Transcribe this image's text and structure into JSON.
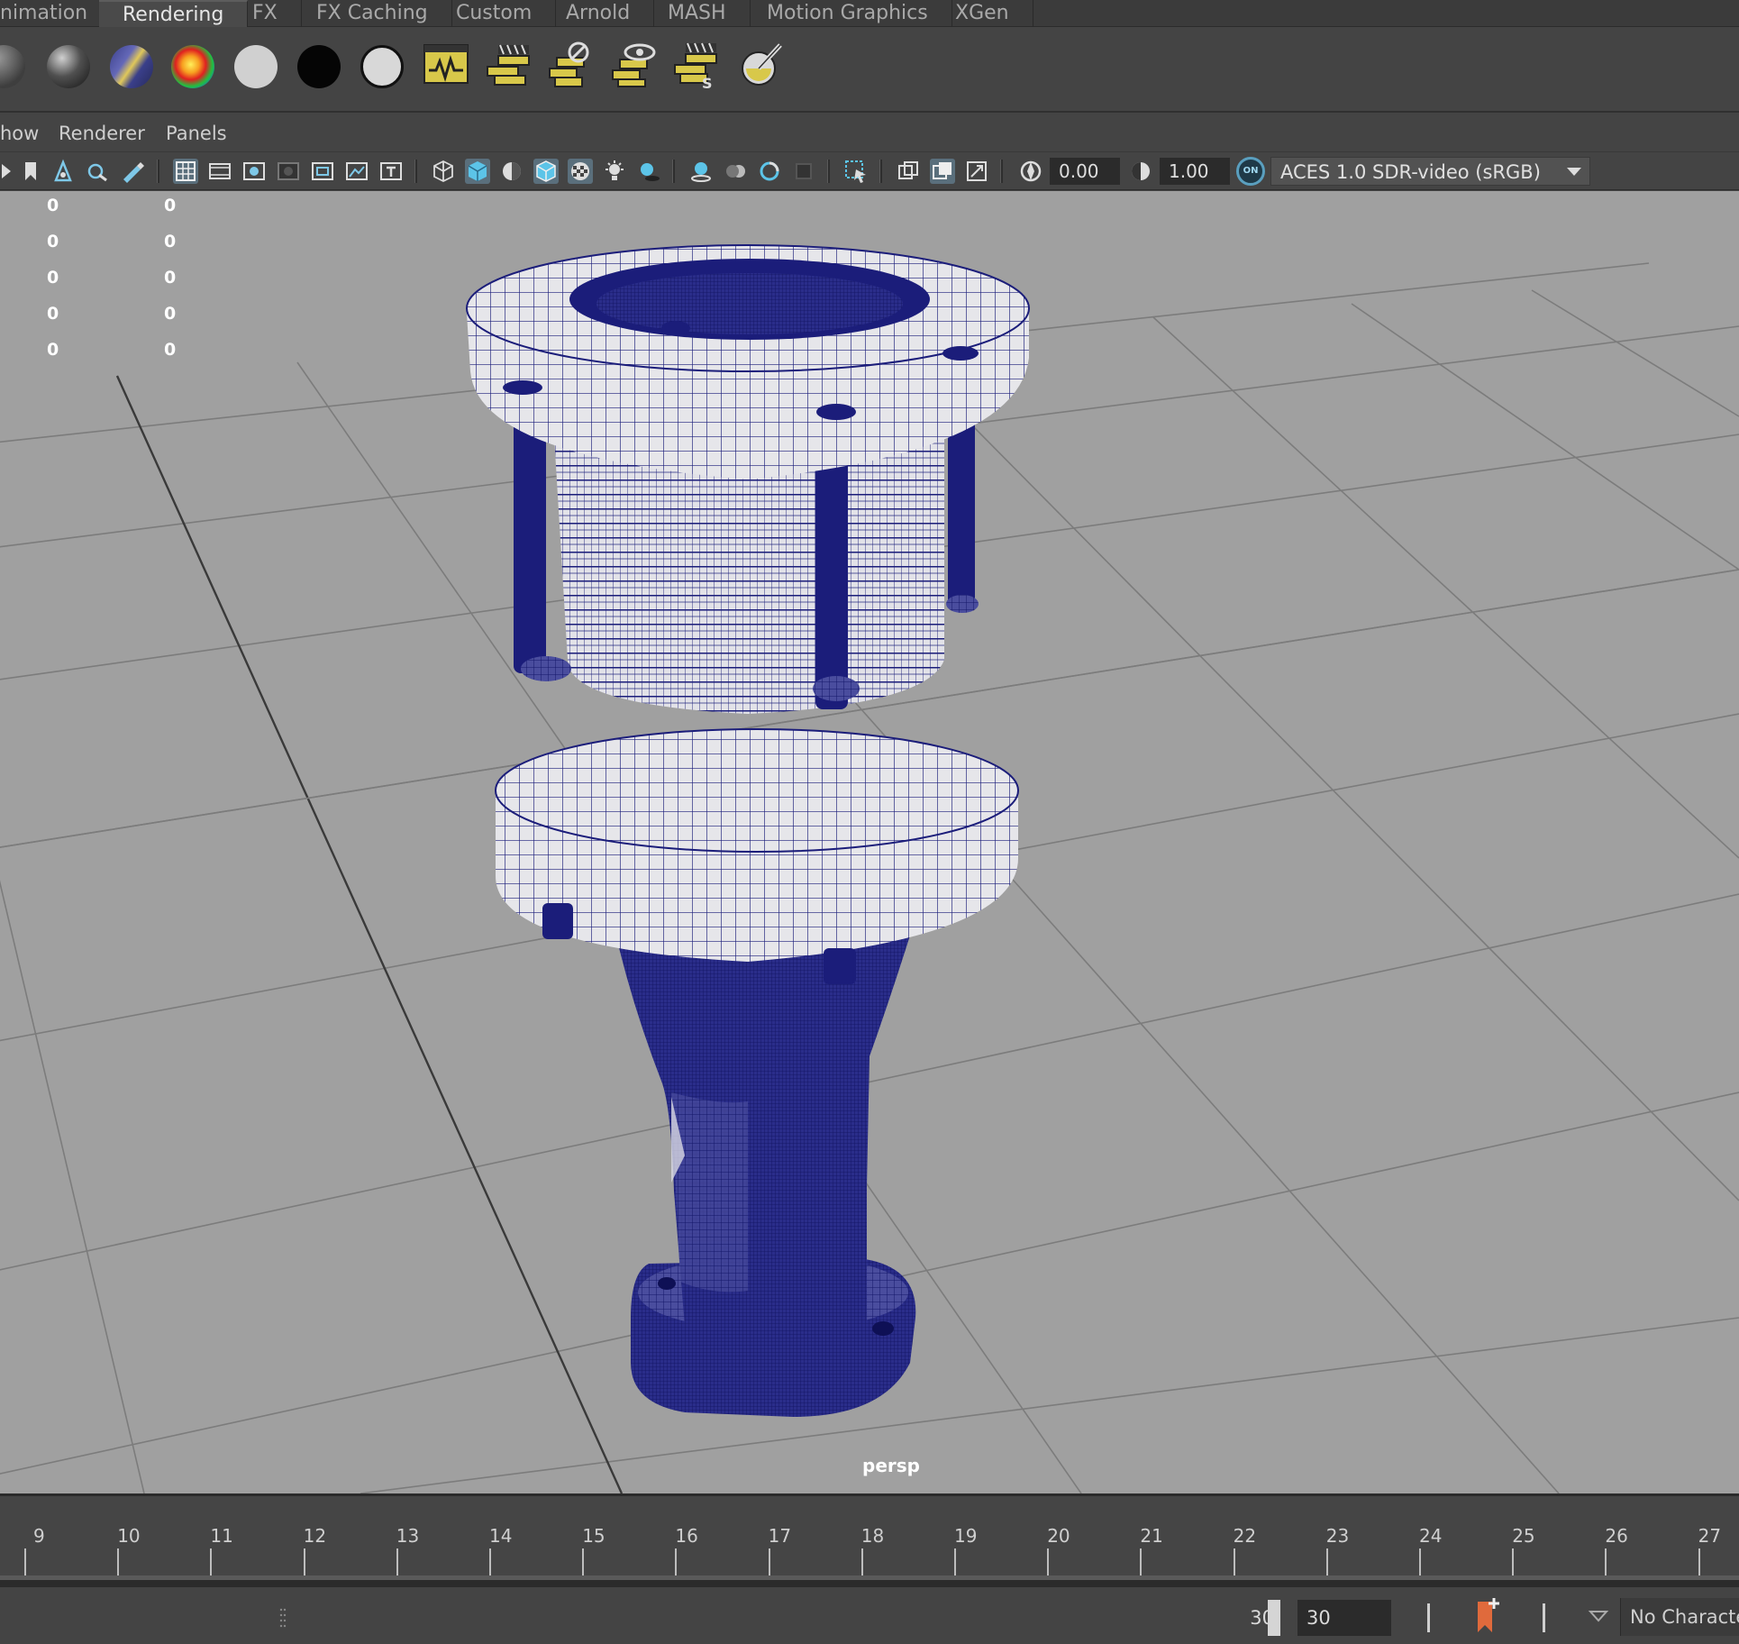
{
  "shelf_tabs": [
    {
      "label": "nimation",
      "active": false
    },
    {
      "label": "Rendering",
      "active": true
    },
    {
      "label": "FX",
      "active": false
    },
    {
      "label": "FX Caching",
      "active": false
    },
    {
      "label": "Custom",
      "active": false
    },
    {
      "label": "Arnold",
      "active": false
    },
    {
      "label": "MASH",
      "active": false
    },
    {
      "label": "Motion Graphics",
      "active": false
    },
    {
      "label": "XGen",
      "active": false
    }
  ],
  "shelf_icons": [
    "lambert-sphere-icon",
    "blinn-sphere-icon",
    "anisotropic-sphere-icon",
    "ramp-shader-icon",
    "surface-shader-white-icon",
    "surface-shader-black-icon",
    "use-background-icon",
    "render-view-icon",
    "render-current-frame-icon",
    "ipr-render-icon",
    "render-settings-icon",
    "batch-render-icon",
    "hypershade-icon"
  ],
  "panel_menu": [
    "how",
    "Renderer",
    "Panels"
  ],
  "toolbar": {
    "exposure": "0.00",
    "gamma": "1.00",
    "color_mgmt_badge": "ON",
    "view_transform": "ACES 1.0 SDR-video (sRGB)"
  },
  "hud_rows": [
    {
      "a": "0",
      "b": "0"
    },
    {
      "a": "0",
      "b": "0"
    },
    {
      "a": "0",
      "b": "0"
    },
    {
      "a": "0",
      "b": "0"
    },
    {
      "a": "0",
      "b": "0"
    }
  ],
  "viewport": {
    "camera": "persp"
  },
  "timeline": {
    "ticks": [
      "9",
      "10",
      "11",
      "12",
      "13",
      "14",
      "15",
      "16",
      "17",
      "18",
      "19",
      "20",
      "21",
      "22",
      "23",
      "24",
      "25",
      "26",
      "27"
    ]
  },
  "range": {
    "end": "30",
    "total": "30",
    "character_set": "No Character Set"
  },
  "colors": {
    "accent": "#5a9fbf",
    "wireframe": "#1b1d7a",
    "viewport_bg": "#a0a0a0",
    "key_marker": "#e06a3c"
  }
}
